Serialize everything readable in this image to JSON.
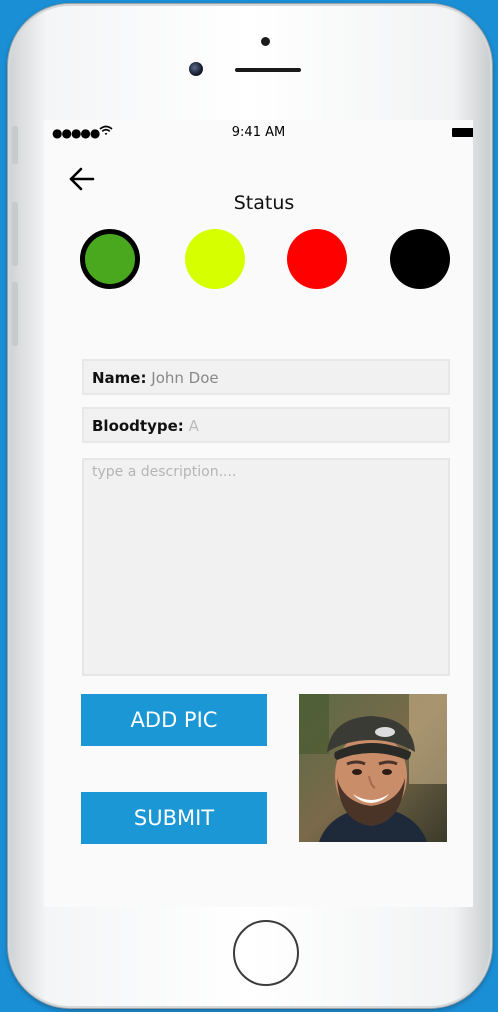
{
  "status_bar": {
    "signal": "●●●●●",
    "wifi": "ᯤ",
    "time": "9:41 AM"
  },
  "header": {
    "title": "Status"
  },
  "status_options": [
    {
      "color": "#4aa81e",
      "selected": true
    },
    {
      "color": "#d6ff00",
      "selected": false
    },
    {
      "color": "#ff0000",
      "selected": false
    },
    {
      "color": "#000000",
      "selected": false
    }
  ],
  "form": {
    "name_label": "Name:",
    "name_value": "John Doe",
    "bloodtype_label": "Bloodtype:",
    "bloodtype_value": "A",
    "description_placeholder": "type a description...."
  },
  "buttons": {
    "add_pic": "ADD PIC",
    "submit": "SUBMIT"
  },
  "icons": {
    "back": "arrow-left-icon"
  }
}
